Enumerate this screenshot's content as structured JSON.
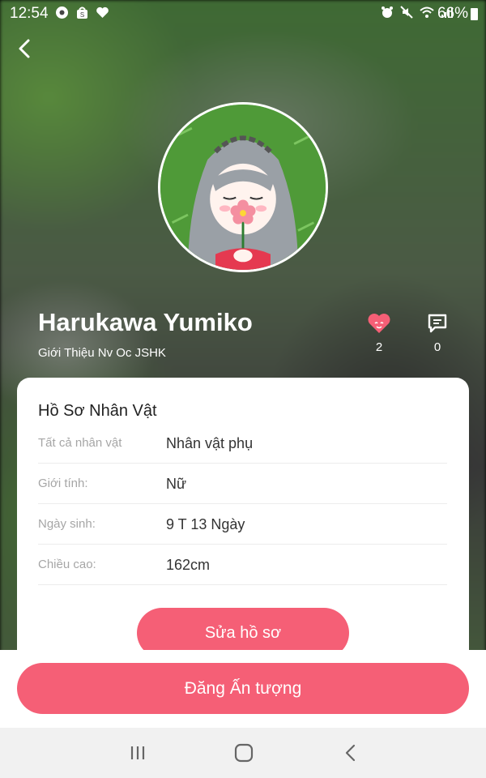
{
  "status_bar": {
    "time": "12:54",
    "battery": "66%",
    "left_icons": [
      "chrome-icon",
      "shop-icon",
      "heart-icon"
    ],
    "right_icons": [
      "alarm-icon",
      "mute-icon",
      "wifi-icon",
      "signal-icon",
      "battery-icon"
    ]
  },
  "header": {
    "back_icon": "chevron-left-icon"
  },
  "profile": {
    "name": "Harukawa Yumiko",
    "subtitle": "Giới Thiệu Nv Oc JSHK",
    "likes": "2",
    "comments": "0"
  },
  "card": {
    "title": "Hồ Sơ Nhân Vật",
    "rows": [
      {
        "label": "Tất cả nhân vật",
        "value": "Nhân vật phụ"
      },
      {
        "label": "Giới tính:",
        "value": "Nữ"
      },
      {
        "label": "Ngày sinh:",
        "value": "9 T 13 Ngày"
      },
      {
        "label": "Chiều cao:",
        "value": "162cm"
      }
    ],
    "edit_label": "Sửa hồ sơ"
  },
  "bottom": {
    "post_label": "Đăng Ấn tượng"
  },
  "colors": {
    "accent": "#f55f76"
  }
}
